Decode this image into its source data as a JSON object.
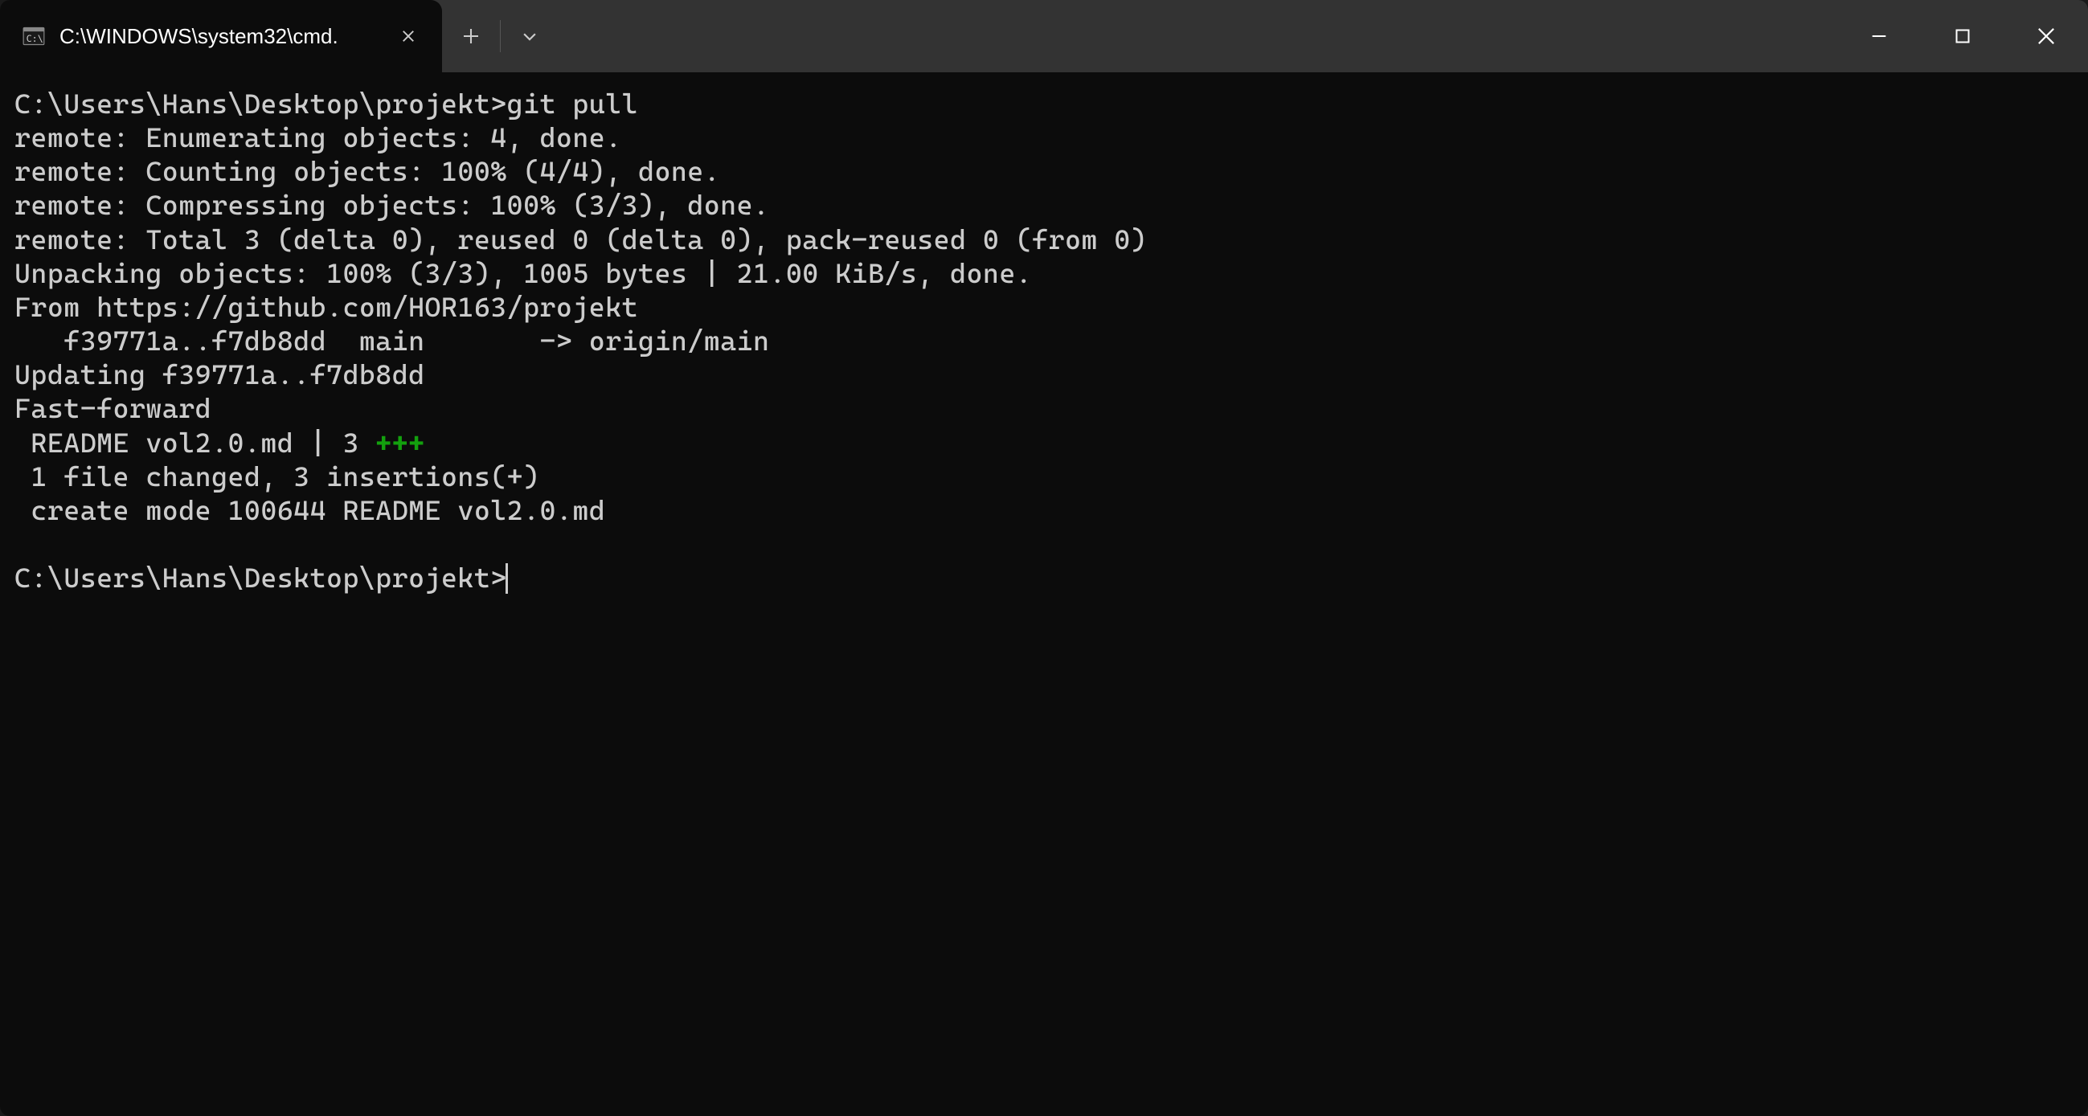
{
  "tab": {
    "title": "C:\\WINDOWS\\system32\\cmd."
  },
  "terminal": {
    "lines": [
      {
        "text": "C:\\Users\\Hans\\Desktop\\projekt>git pull"
      },
      {
        "text": "remote: Enumerating objects: 4, done."
      },
      {
        "text": "remote: Counting objects: 100% (4/4), done."
      },
      {
        "text": "remote: Compressing objects: 100% (3/3), done."
      },
      {
        "text": "remote: Total 3 (delta 0), reused 0 (delta 0), pack-reused 0 (from 0)"
      },
      {
        "text": "Unpacking objects: 100% (3/3), 1005 bytes | 21.00 KiB/s, done."
      },
      {
        "text": "From https://github.com/HOR163/projekt"
      },
      {
        "text": "   f39771a..f7db8dd  main       -> origin/main"
      },
      {
        "text": "Updating f39771a..f7db8dd"
      },
      {
        "text": "Fast-forward"
      },
      {
        "prefix": " README vol2.0.md | 3 ",
        "green": "+++"
      },
      {
        "text": " 1 file changed, 3 insertions(+)"
      },
      {
        "text": " create mode 100644 README vol2.0.md"
      },
      {
        "text": ""
      },
      {
        "text": "C:\\Users\\Hans\\Desktop\\projekt>",
        "cursor": true
      }
    ]
  }
}
